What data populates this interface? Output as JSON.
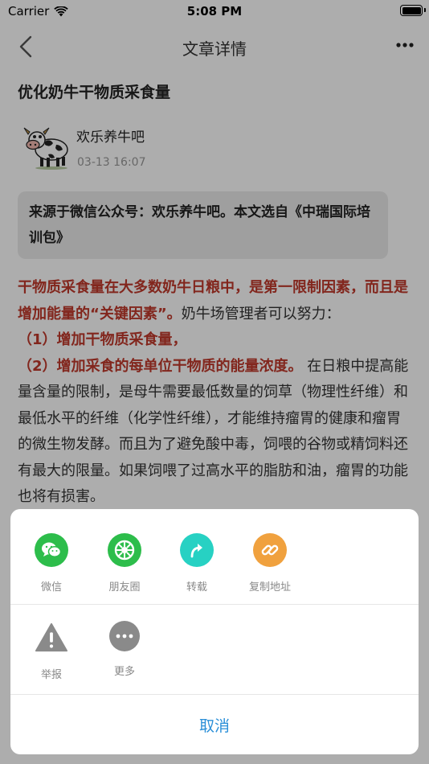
{
  "status_bar": {
    "carrier": "Carrier",
    "time": "5:08 PM"
  },
  "nav": {
    "title": "文章详情",
    "back_icon": "chevron-left-icon",
    "more_icon": "more-dots-icon"
  },
  "article": {
    "title": "优化奶牛干物质采食量",
    "author": "欢乐养牛吧",
    "time": "03-13 16:07",
    "source": "来源于微信公众号：欢乐养牛吧。本文选自《中瑞国际培训包》",
    "body": {
      "p1_red": "干物质采食量在大多数奶牛日粮中，是第一限制因素，而且是增加能量的“关键因素”。",
      "p1_rest": "奶牛场管理者可以努力：",
      "item1": "（1）增加干物质采食量，",
      "item2_red": "（2）增加采食的每单位干物质的能量浓度。",
      "item2_rest": " 在日粮中提高能量含量的限制，是母牛需要最低数量的饲草（物理性纤维）和最低水平的纤维（化学性纤维），才能维持瘤胃的健康和瘤胃的微生物发酵。而且为了避免酸中毒，饲喂的谷物或精饲料还有最大的限量。如果饲喂了过高水平的脂肪和油，瘤胃的功能也将有损害。"
    }
  },
  "share_sheet": {
    "row1": [
      {
        "label": "微信",
        "icon": "wechat-icon",
        "color": "#2dbd4b"
      },
      {
        "label": "朋友圈",
        "icon": "moments-icon",
        "color": "#2dbd4b"
      },
      {
        "label": "转载",
        "icon": "share-arrow-icon",
        "color": "#27d1c3"
      },
      {
        "label": "复制地址",
        "icon": "link-icon",
        "color": "#f0a13e"
      }
    ],
    "row2": [
      {
        "label": "举报",
        "icon": "warning-icon",
        "color": "#8a8a8a"
      },
      {
        "label": "更多",
        "icon": "more-icon",
        "color": "#8a8a8a"
      }
    ],
    "cancel": "取消"
  },
  "colors": {
    "accent_blue": "#2a8fd8",
    "highlight_red": "#c0392b"
  }
}
